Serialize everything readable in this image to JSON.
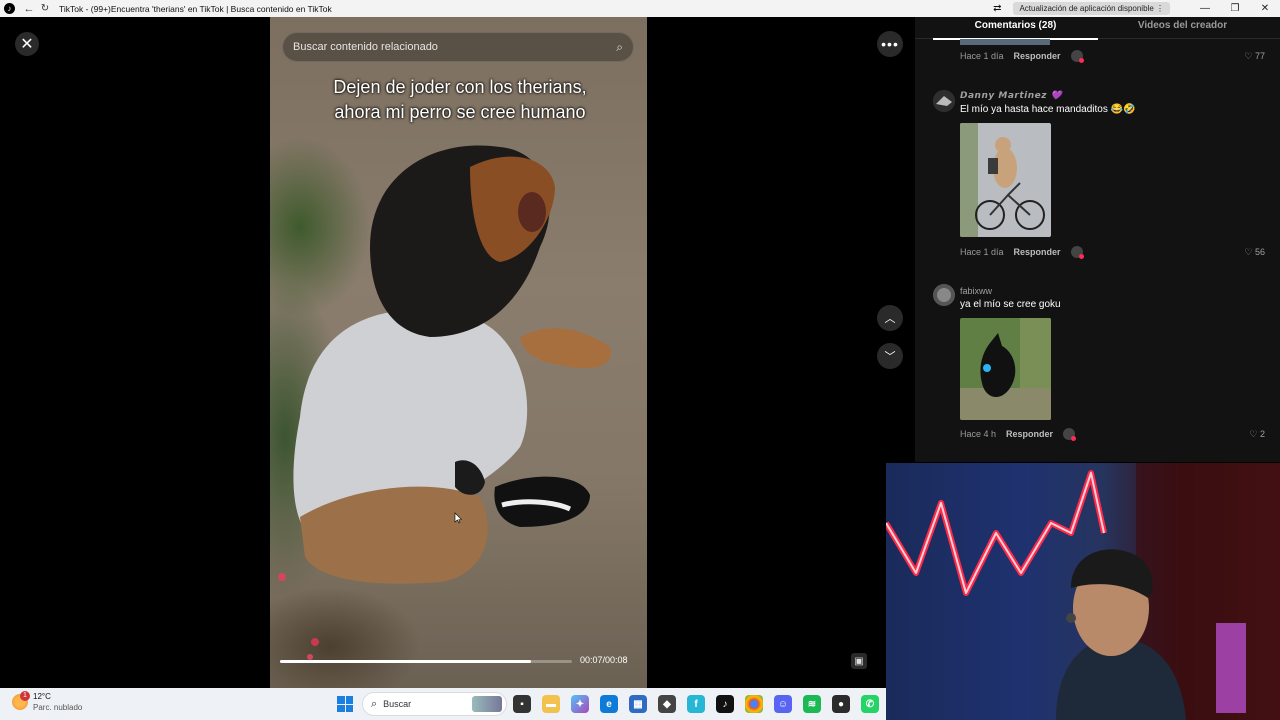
{
  "window": {
    "title": "TikTok - (99+)Encuentra 'therians' en TikTok | Busca contenido en TikTok",
    "update_notice": "Actualización de aplicación disponible"
  },
  "video": {
    "search_placeholder": "Buscar contenido relacionado",
    "caption": "Dejen de joder con los therians, ahora mi perro se cree humano",
    "timecode": "00:07/00:08",
    "progress": 0.86
  },
  "comments_panel": {
    "tab_comments": "Comentarios (28)",
    "tab_creator": "Videos del creador",
    "reply_label": "Responder",
    "comments": [
      {
        "user": "",
        "text": "",
        "time": "Hace 1 día",
        "likes": "77"
      },
      {
        "user": "𝘿𝙖𝙣𝙣𝙮 𝙈𝙖𝙧𝙩𝙞𝙣𝙚𝙯 💜",
        "text": "El mío ya hasta hace mandaditos 😂🤣",
        "time": "Hace 1 día",
        "likes": "56"
      },
      {
        "user": "fabixww",
        "text": "ya el mío se cree goku",
        "time": "Hace 4 h",
        "likes": "2"
      }
    ]
  },
  "taskbar": {
    "temperature": "12°C",
    "condition": "Parc. nublado",
    "notifications": "1",
    "search_label": "Buscar"
  },
  "icons": {
    "close": "close-icon",
    "more": "more-icon",
    "up": "chevron-up-icon",
    "down": "chevron-down-icon",
    "heart": "heart-icon",
    "search": "search-icon"
  }
}
